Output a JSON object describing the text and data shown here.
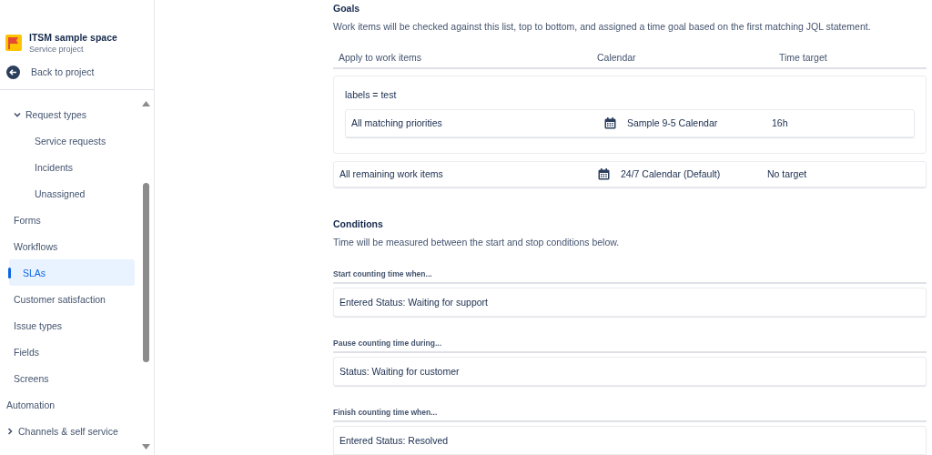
{
  "project": {
    "name": "ITSM sample space",
    "type": "Service project"
  },
  "back_link": "Back to project",
  "sidebar": {
    "nav": [
      {
        "label": "Request types",
        "expanded": true,
        "selected": false,
        "children": [
          {
            "label": "Service requests",
            "selected": false
          },
          {
            "label": "Incidents",
            "selected": false
          },
          {
            "label": "Unassigned",
            "selected": false
          }
        ]
      },
      {
        "label": "Forms",
        "selected": false
      },
      {
        "label": "Workflows",
        "selected": false
      },
      {
        "label": "SLAs",
        "selected": true
      },
      {
        "label": "Customer satisfaction",
        "selected": false
      },
      {
        "label": "Issue types",
        "selected": false
      },
      {
        "label": "Fields",
        "selected": false
      },
      {
        "label": "Screens",
        "selected": false
      }
    ],
    "top_items": [
      {
        "label": "Automation"
      },
      {
        "label": "Channels & self service",
        "expanded": false
      }
    ]
  },
  "goals": {
    "title": "Goals",
    "description": "Work items will be checked against this list, top to bottom, and assigned a time goal based on the first matching JQL statement.",
    "columns": [
      "Apply to work items",
      "Calendar",
      "Time target"
    ],
    "groups": [
      {
        "kind": "group",
        "jql": "labels = test",
        "rows": [
          {
            "apply": "All matching priorities",
            "calendar": "Sample 9-5 Calendar",
            "target": "16h"
          }
        ]
      },
      {
        "kind": "row",
        "rows": [
          {
            "apply": "All remaining work items",
            "calendar": "24/7 Calendar (Default)",
            "target": "No target"
          }
        ]
      }
    ]
  },
  "conditions": {
    "title": "Conditions",
    "description": "Time will be measured between the start and stop conditions below.",
    "sections": [
      {
        "label": "Start counting time when...",
        "value": "Entered Status: Waiting for support"
      },
      {
        "label": "Pause counting time during...",
        "value": "Status: Waiting for customer"
      },
      {
        "label": "Finish counting time when...",
        "value": "Entered Status: Resolved"
      }
    ]
  }
}
